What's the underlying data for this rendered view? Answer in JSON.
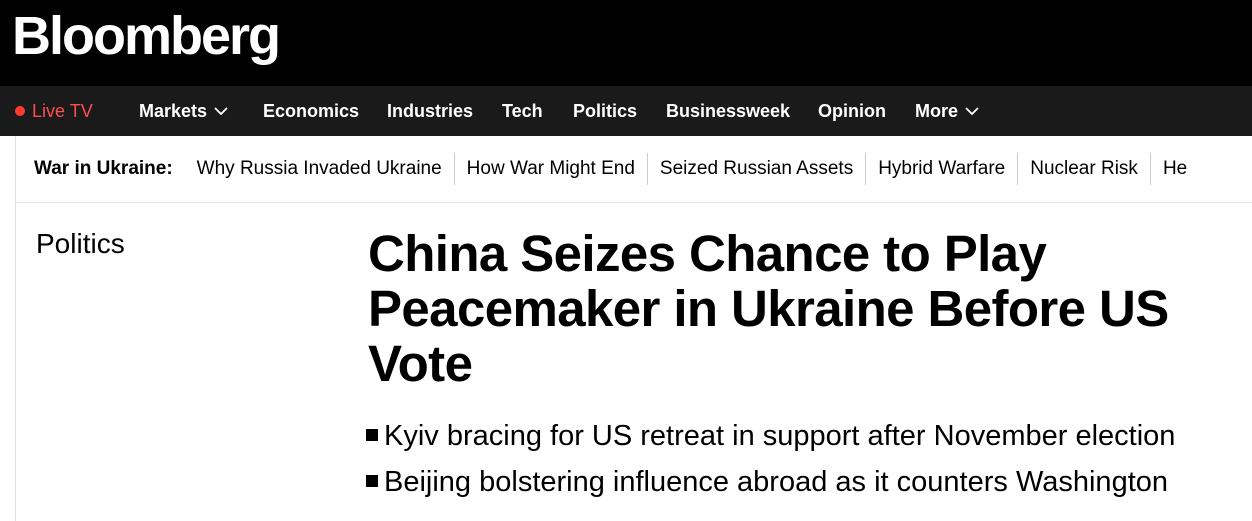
{
  "brand": {
    "logo_text": "Bloomberg"
  },
  "nav": {
    "live_tv": "Live TV",
    "items": [
      {
        "label": "Markets",
        "has_dropdown": true
      },
      {
        "label": "Economics",
        "has_dropdown": false
      },
      {
        "label": "Industries",
        "has_dropdown": false
      },
      {
        "label": "Tech",
        "has_dropdown": false
      },
      {
        "label": "Politics",
        "has_dropdown": false
      },
      {
        "label": "Businessweek",
        "has_dropdown": false
      },
      {
        "label": "Opinion",
        "has_dropdown": false
      },
      {
        "label": "More",
        "has_dropdown": true
      }
    ],
    "dropdown_icon": "chevron-down-icon",
    "live_color": "#ff4d4d"
  },
  "subnav": {
    "label": "War in Ukraine:",
    "links": [
      "Why Russia Invaded Ukraine",
      "How War Might End",
      "Seized Russian Assets",
      "Hybrid Warfare",
      "Nuclear Risk",
      "He"
    ]
  },
  "article": {
    "section": "Politics",
    "headline": "China Seizes Chance to Play Peacemaker in Ukraine Before US Vote",
    "bullets": [
      "Kyiv bracing for US retreat in support after November election",
      "Beijing bolstering influence abroad as it counters Washington"
    ]
  },
  "colors": {
    "header_bg": "#000000",
    "nav_bg": "#1a1a1a",
    "live_dot": "#ff3b30"
  }
}
